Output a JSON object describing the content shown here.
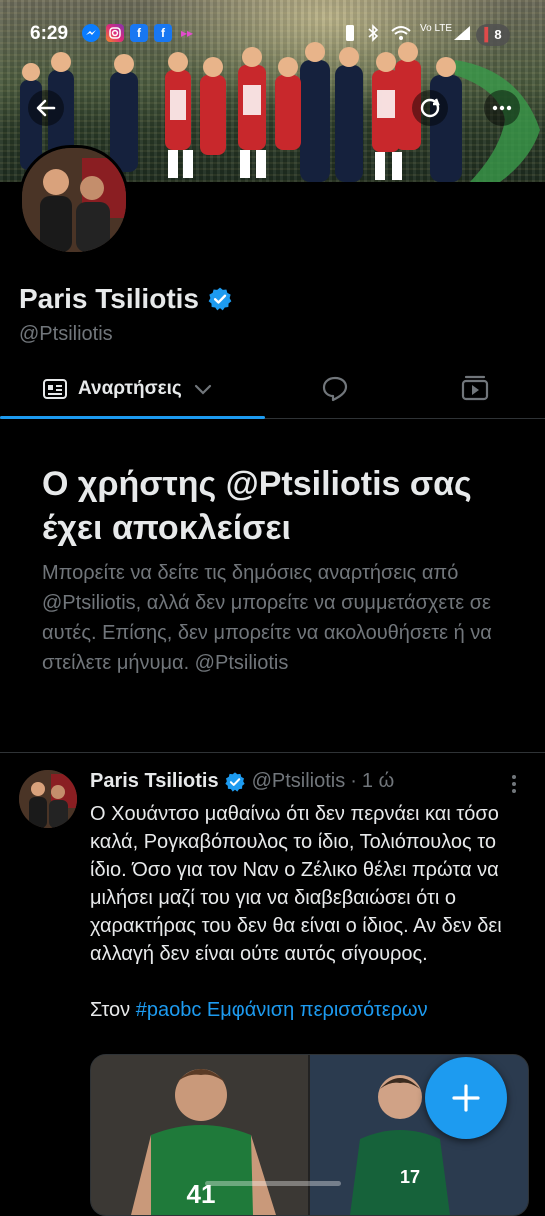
{
  "status_bar": {
    "time": "6:29",
    "notif_icons": [
      "messenger-icon",
      "instagram-icon",
      "facebook-icon",
      "facebook-icon",
      "flow-icon"
    ],
    "carrier": "Vo LTE",
    "badge": "8"
  },
  "header": {
    "back_icon": "arrow-left-icon",
    "refresh_icon": "refresh-icon",
    "more_icon": "more-horizontal-icon"
  },
  "profile": {
    "name": "Paris Tsiliotis",
    "handle": "@Ptsiliotis",
    "verified": true
  },
  "tabs": {
    "posts_label": "Αναρτήσεις",
    "posts_icon": "timeline-icon",
    "replies_icon": "reply-bubble-icon",
    "media_icon": "video-icon"
  },
  "blocked": {
    "title": "Ο χρήστης @Ptsiliotis σας έχει αποκλείσει",
    "body": "Μπορείτε να δείτε τις δημόσιες αναρτήσεις από @Ptsiliotis, αλλά δεν μπορείτε να συμμετάσχετε σε αυτές. Επίσης, δεν μπορείτε να ακολουθήσετε ή να στείλετε μήνυμα. @Ptsiliotis"
  },
  "tweet": {
    "name": "Paris Tsiliotis",
    "handle": "@Ptsiliotis",
    "separator": "·",
    "time": "1 ώ",
    "text": "Ο Χουάντσο μαθαίνω ότι δεν περνάει και τόσο καλά, Ρογκαβόπουλος το ίδιο, Τολιόπουλος το ίδιο. Όσο για τον Ναν ο Ζέλικο θέλει πρώτα να μιλήσει μαζί του για να διαβεβαιώσει ότι ο χαρακτήρας του δεν θα είναι ο ίδιος. Αν δεν δει αλλαγή δεν είναι ούτε αυτός σίγουρος.",
    "text_lead": "Στον",
    "hashtag": "#paobc",
    "show_more": "Εμφάνιση περισσότερων",
    "jersey_left": "41",
    "jersey_right": "17"
  },
  "fab": {
    "icon": "plus-icon"
  },
  "colors": {
    "accent": "#1d9bf0",
    "background": "#000000",
    "muted": "#71767b",
    "text": "#e7e9ea"
  }
}
